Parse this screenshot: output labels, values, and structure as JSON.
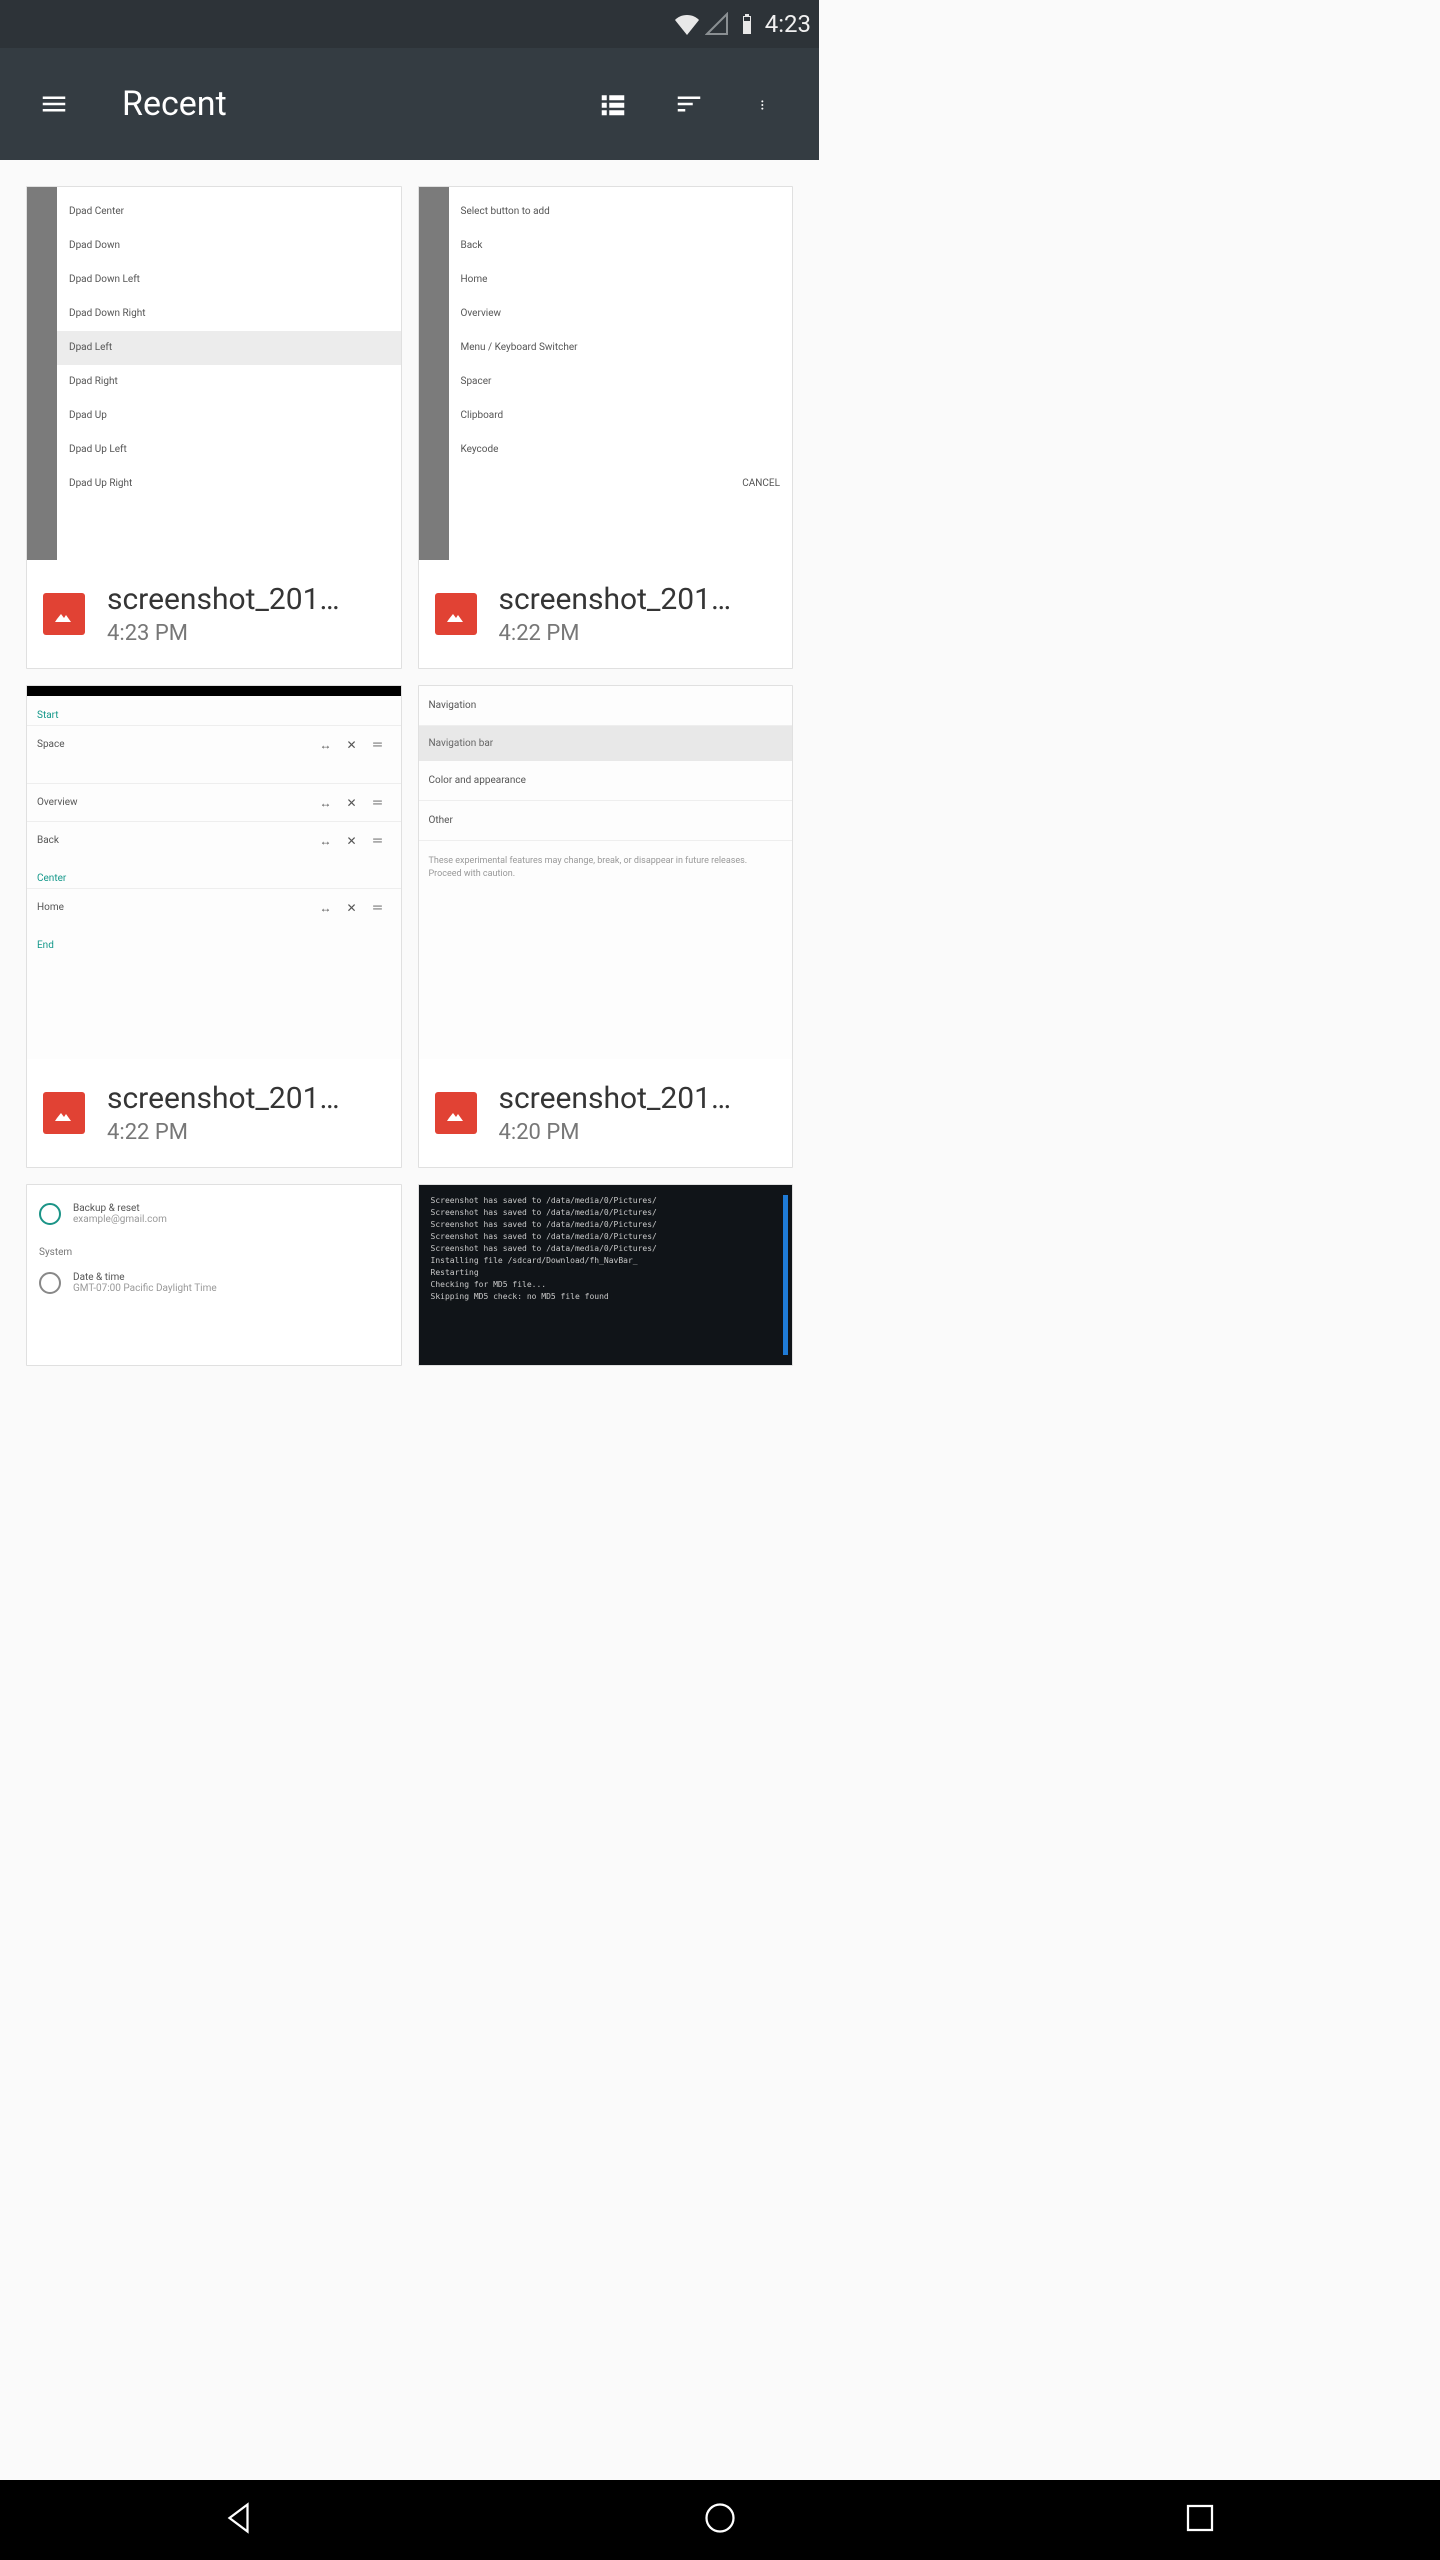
{
  "status": {
    "time": "4:23"
  },
  "toolbar": {
    "title": "Recent"
  },
  "files": [
    {
      "name": "screenshot_201…",
      "time": "4:23 PM"
    },
    {
      "name": "screenshot_201…",
      "time": "4:22 PM"
    },
    {
      "name": "screenshot_201…",
      "time": "4:22 PM"
    },
    {
      "name": "screenshot_201…",
      "time": "4:20 PM"
    }
  ],
  "thumbs": {
    "t0": [
      "Dpad Center",
      "Dpad Down",
      "Dpad Down Left",
      "Dpad Down Right",
      "Dpad Left",
      "Dpad Right",
      "Dpad Up",
      "Dpad Up Left",
      "Dpad Up Right"
    ],
    "t1": {
      "title": "Select button to add",
      "items": [
        "Back",
        "Home",
        "Overview",
        "Menu / Keyboard Switcher",
        "Spacer",
        "Clipboard",
        "Keycode"
      ],
      "cancel": "CANCEL"
    },
    "t2": {
      "sections": [
        {
          "label": "Start",
          "rows": [
            {
              "n": "Space",
              "a": "↔",
              "b": "✕",
              "c": "＝"
            }
          ]
        },
        {
          "label": "",
          "rows": [
            {
              "n": "Overview",
              "a": "↔",
              "b": "✕",
              "c": "＝"
            },
            {
              "n": "Back",
              "a": "↔",
              "b": "✕",
              "c": "＝"
            }
          ]
        },
        {
          "label": "Center",
          "rows": [
            {
              "n": "Home",
              "a": "↔",
              "b": "✕",
              "c": "＝"
            }
          ]
        },
        {
          "label": "End",
          "rows": []
        }
      ]
    },
    "t3": {
      "hd": "Navigation bar",
      "items": [
        "Color and appearance",
        "Other"
      ],
      "note": "These experimental features may change, break, or disappear in future releases. Proceed with caution."
    },
    "t4": {
      "lines": [
        "Backup & reset",
        "example@gmail.com"
      ],
      "sect": "System",
      "date": "Date & time",
      "tz": "GMT-07:00 Pacific Daylight Time"
    },
    "t5": {
      "lines": [
        "Screenshot has saved to /data/media/0/Pictures/",
        "Screenshot has saved to /data/media/0/Pictures/",
        "Screenshot has saved to /data/media/0/Pictures/",
        "Screenshot has saved to /data/media/0/Pictures/",
        "Screenshot has saved to /data/media/0/Pictures/",
        "Installing file /sdcard/Download/fh_NavBar_",
        "Restarting",
        "Checking for MD5 file...",
        "Skipping MD5 check: no MD5 file found"
      ]
    }
  }
}
